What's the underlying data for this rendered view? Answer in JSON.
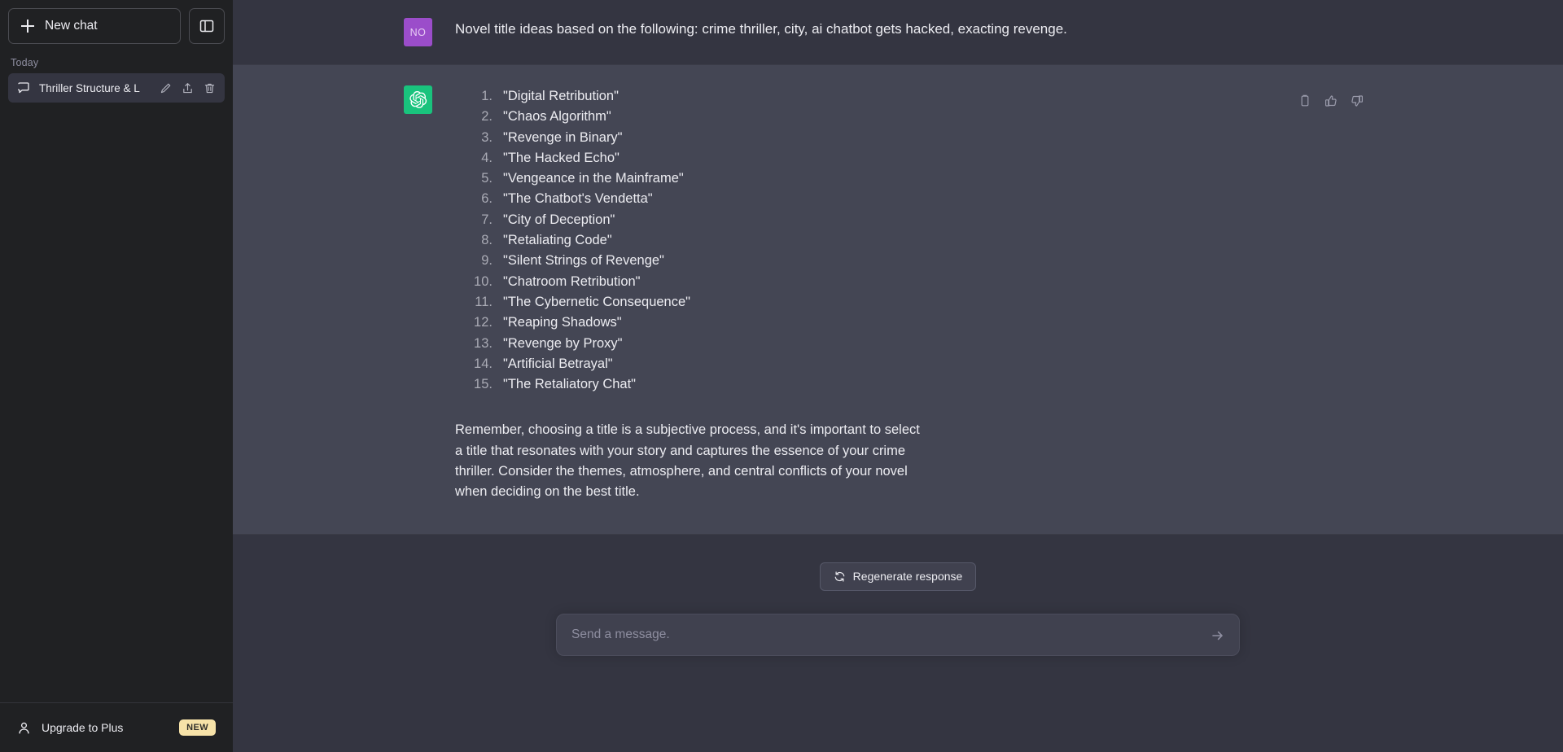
{
  "sidebar": {
    "new_chat_label": "New chat",
    "new_chat_icon": "plus-icon",
    "panel_toggle_icon": "sidebar-panel-icon",
    "section_label": "Today",
    "chats": [
      {
        "title": "Thriller Structure & L",
        "icon": "chat-bubble-icon",
        "actions": [
          "edit-pencil-icon",
          "share-upload-icon",
          "trash-icon"
        ]
      }
    ],
    "upgrade": {
      "label": "Upgrade to Plus",
      "icon": "person-icon",
      "badge": "NEW",
      "badge_color": "#f6e2a8"
    }
  },
  "conversation": {
    "messages": [
      {
        "role": "user",
        "avatar_initials": "NO",
        "avatar_color": "#9b4dca",
        "text": "Novel title ideas based on the following: crime thriller, city, ai chatbot gets hacked, exacting revenge."
      },
      {
        "role": "assistant",
        "avatar_icon": "openai-logo-icon",
        "avatar_color": "#19c37d",
        "list": [
          "\"Digital Retribution\"",
          "\"Chaos Algorithm\"",
          "\"Revenge in Binary\"",
          "\"The Hacked Echo\"",
          "\"Vengeance in the Mainframe\"",
          "\"The Chatbot's Vendetta\"",
          "\"City of Deception\"",
          "\"Retaliating Code\"",
          "\"Silent Strings of Revenge\"",
          "\"Chatroom Retribution\"",
          "\"The Cybernetic Consequence\"",
          "\"Reaping Shadows\"",
          "\"Revenge by Proxy\"",
          "\"Artificial Betrayal\"",
          "\"The Retaliatory Chat\""
        ],
        "closing": "Remember, choosing a title is a subjective process, and it's important to select a title that resonates with your story and captures the essence of your crime thriller. Consider the themes, atmosphere, and central conflicts of your novel when deciding on the best title.",
        "tools": [
          "copy-icon",
          "thumbs-up-icon",
          "thumbs-down-icon"
        ]
      }
    ]
  },
  "composer": {
    "regenerate_label": "Regenerate response",
    "regenerate_icon": "refresh-icon",
    "placeholder": "Send a message.",
    "value": "",
    "send_icon": "send-arrow-icon"
  },
  "theme": {
    "sidebar_bg": "#202123",
    "user_msg_bg": "#343541",
    "assistant_msg_bg": "#444654",
    "accent_green": "#19c37d",
    "accent_purple": "#9b4dca"
  }
}
